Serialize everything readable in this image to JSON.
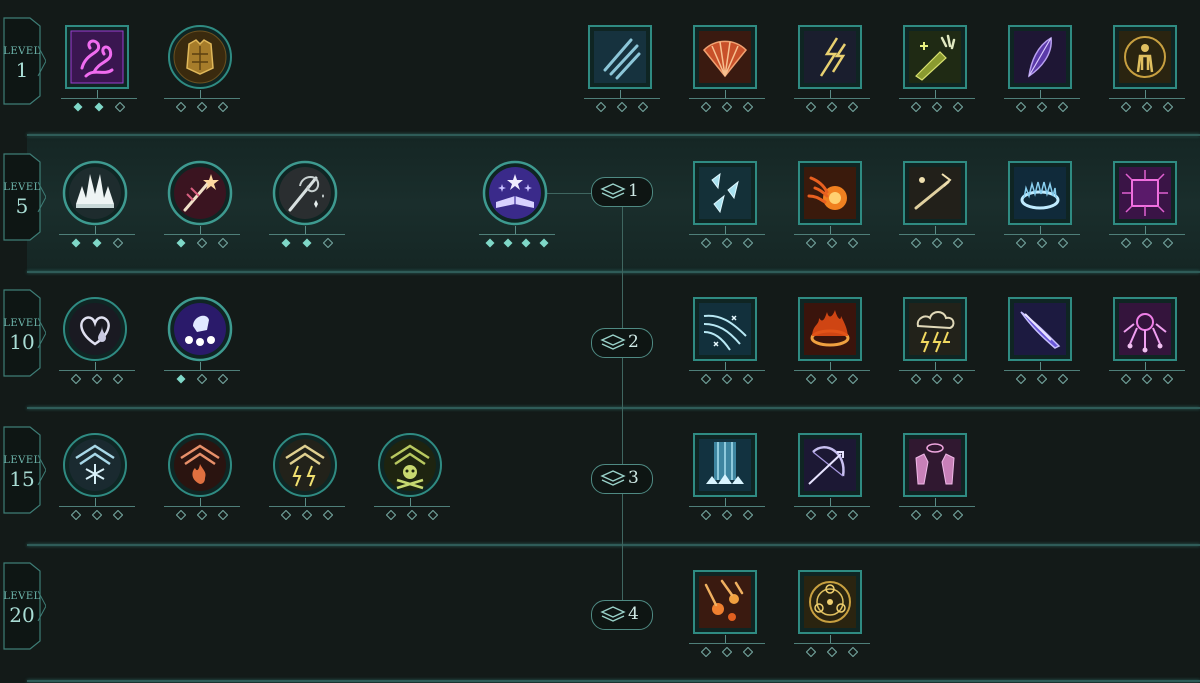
{
  "levels": [
    {
      "label": "LEVEL",
      "value": "1"
    },
    {
      "label": "LEVEL",
      "value": "5"
    },
    {
      "label": "LEVEL",
      "value": "10"
    },
    {
      "label": "LEVEL",
      "value": "15"
    },
    {
      "label": "LEVEL",
      "value": "20"
    }
  ],
  "subclass_badges": [
    "1",
    "2",
    "3",
    "4"
  ],
  "colors": {
    "background": "#131a18",
    "active_tier": "#1a2e2c",
    "frame_teal": "#3e8a82",
    "pip_filled": "#7fd8c8",
    "pip_empty": "#6f9e98"
  },
  "tier_1": {
    "passives": [
      {
        "icon": "arcane-swirl-icon",
        "shape": "square",
        "selected_pips": 2,
        "total_pips": 3
      },
      {
        "icon": "golden-armor-icon",
        "shape": "circle",
        "selected_pips": 0,
        "total_pips": 3
      }
    ],
    "spells": [
      {
        "icon": "claw-slash-icon",
        "selected_pips": 0,
        "total_pips": 3
      },
      {
        "icon": "fire-fan-icon",
        "selected_pips": 0,
        "total_pips": 3
      },
      {
        "icon": "lightning-bolts-icon",
        "selected_pips": 0,
        "total_pips": 3
      },
      {
        "icon": "healing-hand-icon",
        "selected_pips": 0,
        "total_pips": 3
      },
      {
        "icon": "arcane-feather-icon",
        "selected_pips": 0,
        "total_pips": 3
      },
      {
        "icon": "golden-figure-icon",
        "selected_pips": 0,
        "total_pips": 3
      }
    ]
  },
  "tier_5": {
    "passives": [
      {
        "icon": "white-burst-icon",
        "selected_pips": 2,
        "total_pips": 3
      },
      {
        "icon": "magic-wand-icon",
        "selected_pips": 1,
        "total_pips": 3
      },
      {
        "icon": "staff-swirl-icon",
        "selected_pips": 2,
        "total_pips": 3
      }
    ],
    "subclass": {
      "icon": "spellbook-stars-icon",
      "selected_pips": 4,
      "total_pips": 4
    },
    "spells": [
      {
        "icon": "ice-shards-icon",
        "selected_pips": 0,
        "total_pips": 3
      },
      {
        "icon": "fireball-icon",
        "selected_pips": 0,
        "total_pips": 3
      },
      {
        "icon": "arcane-bolt-icon",
        "selected_pips": 0,
        "total_pips": 3
      },
      {
        "icon": "frost-ring-icon",
        "selected_pips": 0,
        "total_pips": 3
      },
      {
        "icon": "arcane-box-icon",
        "selected_pips": 0,
        "total_pips": 3
      }
    ]
  },
  "tier_10": {
    "passives": [
      {
        "icon": "heart-drop-icon",
        "selected_pips": 0,
        "total_pips": 3
      },
      {
        "icon": "orb-hand-icon",
        "selected_pips": 1,
        "total_pips": 3
      }
    ],
    "spells": [
      {
        "icon": "frost-wind-icon",
        "selected_pips": 0,
        "total_pips": 3
      },
      {
        "icon": "fire-ring-icon",
        "selected_pips": 0,
        "total_pips": 3
      },
      {
        "icon": "storm-cloud-icon",
        "selected_pips": 0,
        "total_pips": 3
      },
      {
        "icon": "arcane-spear-icon",
        "selected_pips": 0,
        "total_pips": 3
      },
      {
        "icon": "arcane-burst-icon",
        "selected_pips": 0,
        "total_pips": 3
      }
    ]
  },
  "tier_15": {
    "passives": [
      {
        "icon": "frost-rank-icon",
        "selected_pips": 0,
        "total_pips": 3
      },
      {
        "icon": "fire-rank-icon",
        "selected_pips": 0,
        "total_pips": 3
      },
      {
        "icon": "lightning-rank-icon",
        "selected_pips": 0,
        "total_pips": 3
      },
      {
        "icon": "poison-rank-icon",
        "selected_pips": 0,
        "total_pips": 3
      }
    ],
    "spells": [
      {
        "icon": "ice-pillar-icon",
        "selected_pips": 0,
        "total_pips": 3
      },
      {
        "icon": "arcane-bow-icon",
        "selected_pips": 0,
        "total_pips": 3
      },
      {
        "icon": "twin-hands-icon",
        "selected_pips": 0,
        "total_pips": 3
      }
    ]
  },
  "tier_20": {
    "spells": [
      {
        "icon": "meteor-shower-icon",
        "selected_pips": 0,
        "total_pips": 3
      },
      {
        "icon": "golden-sigil-icon",
        "selected_pips": 0,
        "total_pips": 3
      }
    ]
  }
}
